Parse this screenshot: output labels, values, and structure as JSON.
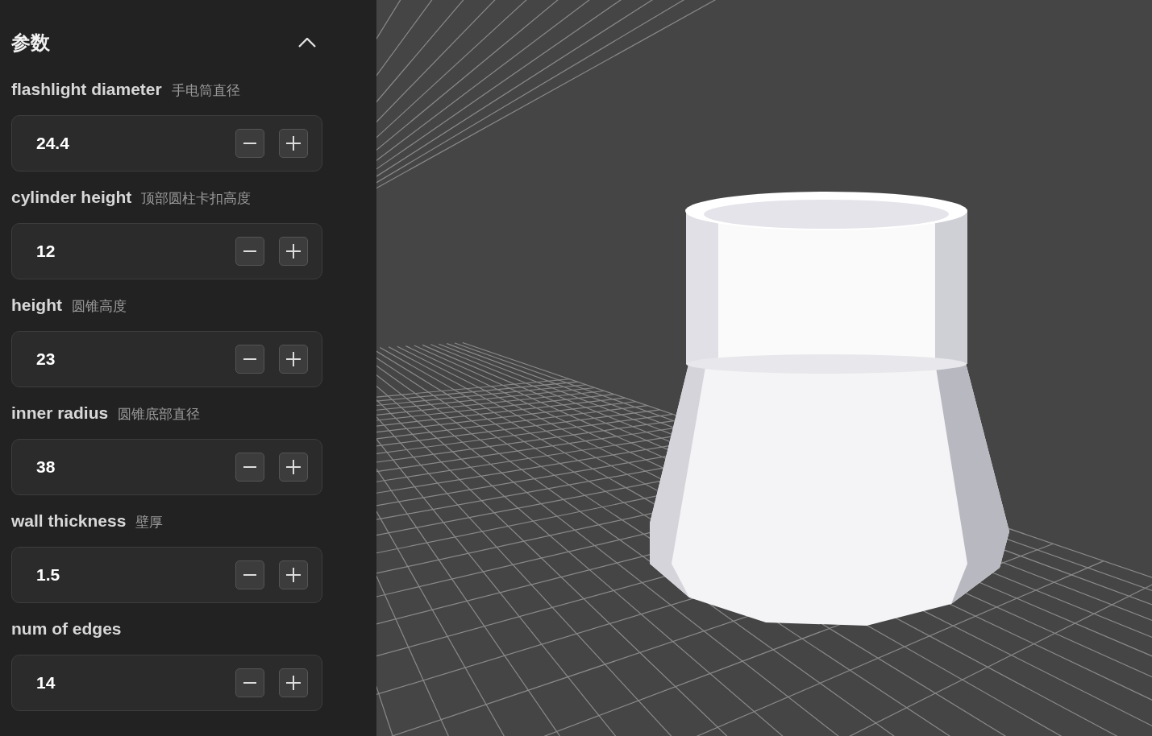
{
  "panel": {
    "title": "参数",
    "expanded": true
  },
  "params": [
    {
      "label": "flashlight diameter",
      "hint": "手电筒直径",
      "value": "24.4"
    },
    {
      "label": "cylinder height",
      "hint": "顶部圆柱卡扣高度",
      "value": "12"
    },
    {
      "label": "height",
      "hint": "圆锥高度",
      "value": "23"
    },
    {
      "label": "inner radius",
      "hint": "圆锥底部直径",
      "value": "38"
    },
    {
      "label": "wall thickness",
      "hint": "壁厚",
      "value": "1.5"
    },
    {
      "label": "num of edges",
      "value": "14"
    }
  ]
}
